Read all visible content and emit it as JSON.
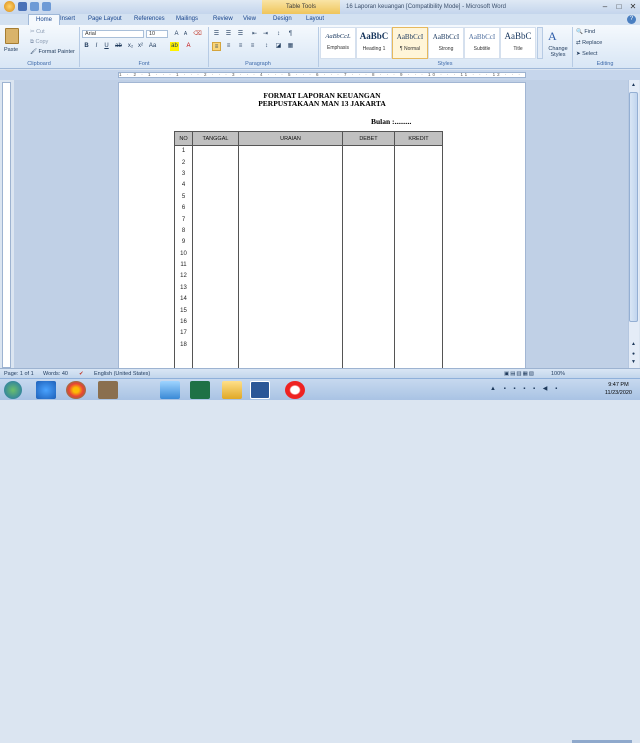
{
  "title_bar": {
    "contextual_tab": "Table Tools",
    "window_title": "16 Laporan keuangan [Compatibility Mode] - Microsoft Word",
    "controls": [
      "minimize",
      "maximize",
      "close"
    ]
  },
  "tabs": [
    {
      "label": "Home",
      "active": true
    },
    {
      "label": "Insert"
    },
    {
      "label": "Page Layout"
    },
    {
      "label": "References"
    },
    {
      "label": "Mailings"
    },
    {
      "label": "Review"
    },
    {
      "label": "View"
    },
    {
      "label": "Design"
    },
    {
      "label": "Layout"
    }
  ],
  "ribbon": {
    "clipboard": {
      "paste": "Paste",
      "cut": "Cut",
      "copy": "Copy",
      "format_painter": "Format Painter",
      "label": "Clipboard"
    },
    "font": {
      "font_name": "Arial",
      "font_size": "10",
      "label": "Font"
    },
    "paragraph": {
      "label": "Paragraph"
    },
    "styles": {
      "label": "Styles",
      "items": [
        {
          "sample": "AaBbCcL",
          "name": "Emphasis"
        },
        {
          "sample": "AaBbC",
          "name": "Heading 1"
        },
        {
          "sample": "AaBbCcI",
          "name": "¶ Normal"
        },
        {
          "sample": "AaBbCcI",
          "name": "Strong"
        },
        {
          "sample": "AaBbCcI",
          "name": "Subtitle"
        },
        {
          "sample": "AaBbC",
          "name": "Title"
        }
      ],
      "change_styles": "Change Styles"
    },
    "editing": {
      "find": "Find",
      "replace": "Replace",
      "select": "Select",
      "label": "Editing"
    }
  },
  "ruler": {
    "marks": "1 · 2 · 1 · · · 1 · · · 2 · · · 3 · · · 4 · · · 5 · · · 6 · · · 7 · · · 8 · · · 9 · · · 10 · · · 11 · · · 12 · · · 13 · · · 14 · · · 15"
  },
  "document": {
    "title_line1": "FORMAT LAPORAN KEUANGAN",
    "title_line2": "PERPUSTAKAAN MAN 13 JAKARTA",
    "bulan": "Bulan :.........",
    "table": {
      "headers": [
        "NO",
        "TANGGAL",
        "URAIAN",
        "DEBET",
        "KREDIT"
      ],
      "rows": [
        "1",
        "2",
        "3",
        "4",
        "5",
        "6",
        "7",
        "8",
        "9",
        "10",
        "11",
        "12",
        "13",
        "14",
        "15",
        "16",
        "17",
        "18"
      ]
    }
  },
  "status_bar": {
    "page": "Page: 1 of 1",
    "words": "Words: 40",
    "language": "English (United States)",
    "zoom": "100%"
  },
  "taskbar": {
    "time": "9:47 PM",
    "date": "11/23/2020"
  }
}
